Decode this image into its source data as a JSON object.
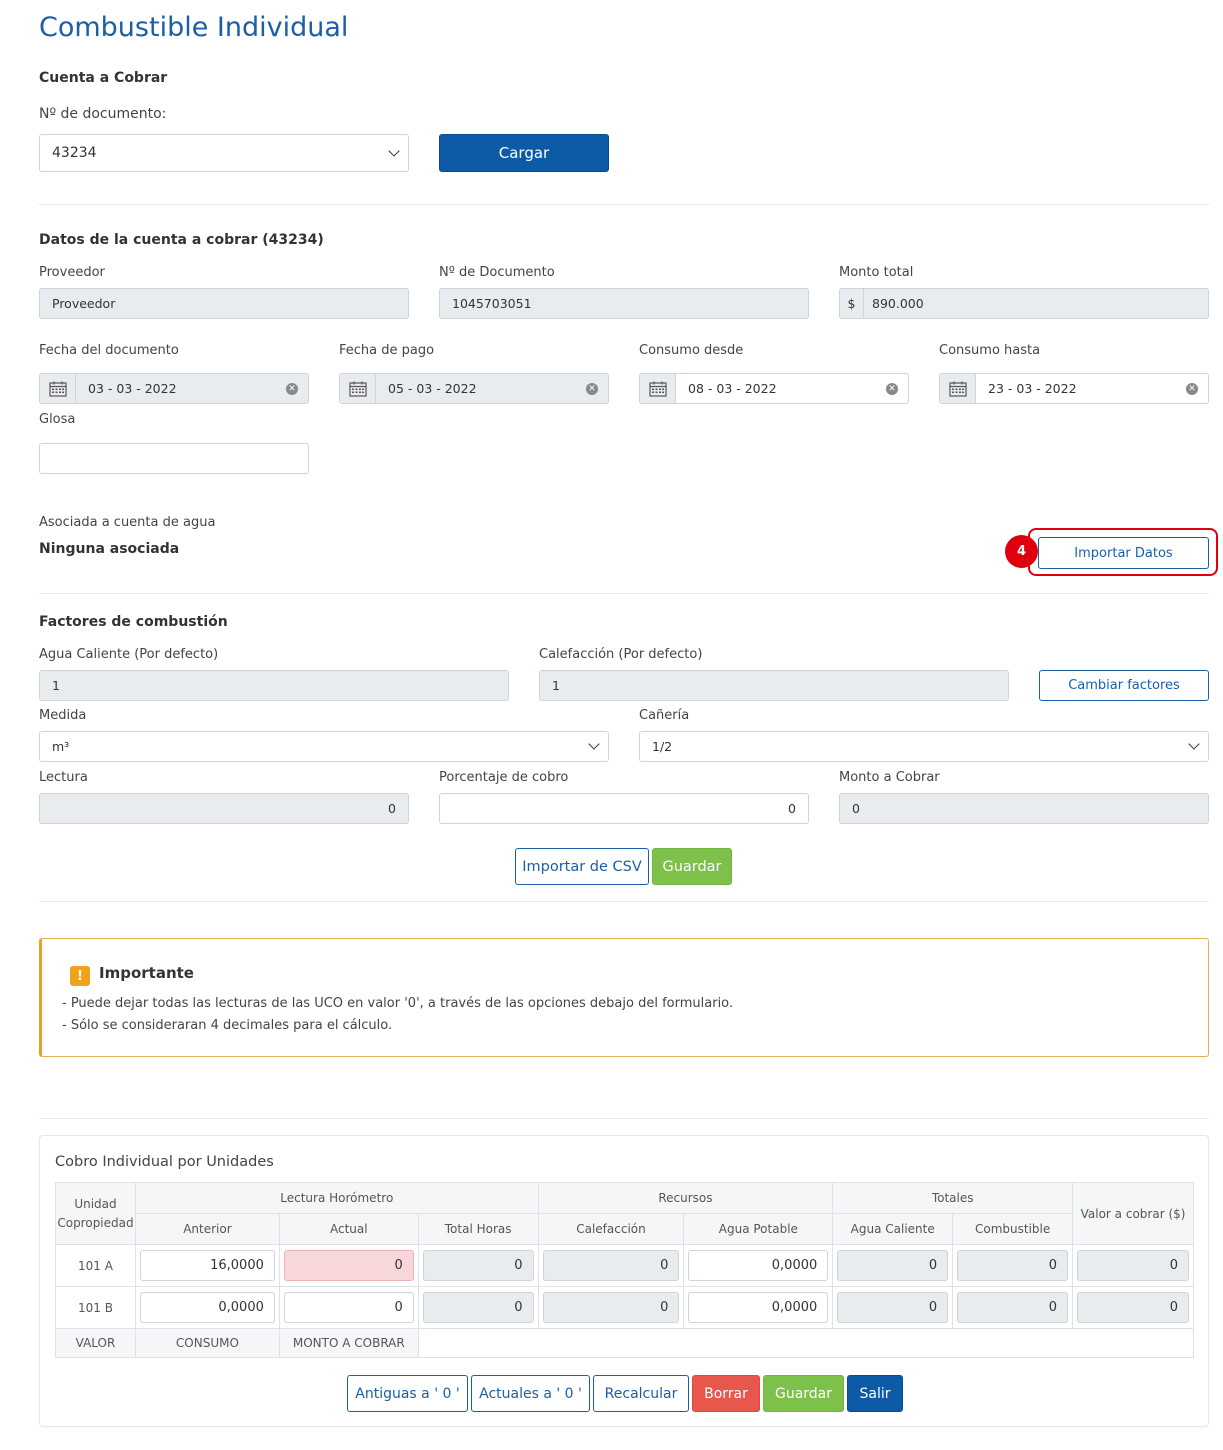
{
  "page_title": "Combustible Individual",
  "cuenta_section": {
    "heading": "Cuenta a Cobrar",
    "doc_label": "Nº de documento:",
    "doc_selected": "43234",
    "load_button": "Cargar"
  },
  "datos": {
    "heading": "Datos de la cuenta a cobrar (43234)",
    "proveedor_label": "Proveedor",
    "proveedor_value": "Proveedor",
    "ndoc_label": "Nº de Documento",
    "ndoc_value": "1045703051",
    "monto_label": "Monto total",
    "monto_prefix": "$",
    "monto_value": "890.000",
    "fecha_doc_label": "Fecha del documento",
    "fecha_doc_value": "03 - 03 - 2022",
    "fecha_pago_label": "Fecha de pago",
    "fecha_pago_value": "05 - 03 - 2022",
    "consumo_desde_label": "Consumo desde",
    "consumo_desde_value": "08 - 03 - 2022",
    "consumo_hasta_label": "Consumo hasta",
    "consumo_hasta_value": "23 - 03 - 2022",
    "glosa_label": "Glosa",
    "glosa_value": "",
    "asociada_label": "Asociada a cuenta de agua",
    "asociada_value": "Ninguna asociada",
    "import_button": "Importar Datos",
    "step_badge": "4"
  },
  "factores": {
    "heading": "Factores de combustión",
    "agua_label": "Agua Caliente (Por defecto)",
    "agua_value": "1",
    "calef_label": "Calefacción (Por defecto)",
    "calef_value": "1",
    "cambiar_button": "Cambiar factores",
    "medida_label": "Medida",
    "medida_value": "m³",
    "caneria_label": "Cañería",
    "caneria_value": "1/2",
    "lectura_label": "Lectura",
    "lectura_value": "0",
    "porcentaje_label": "Porcentaje de cobro",
    "porcentaje_value": "0",
    "monto_cobrar_label": "Monto a Cobrar",
    "monto_cobrar_value": "0",
    "csv_button": "Importar de CSV",
    "save_button": "Guardar"
  },
  "alert": {
    "icon": "exclamation-icon",
    "title": "Importante",
    "line1": "- Puede dejar todas las lecturas de las UCO en valor '0', a través de las opciones debajo del formulario.",
    "line2": "- Sólo se consideraran 4 decimales para el cálculo."
  },
  "table": {
    "title": "Cobro Individual por Unidades",
    "h_unidad": "Unidad Copropiedad",
    "h_lectura": "Lectura Horómetro",
    "h_recursos": "Recursos",
    "h_totales": "Totales",
    "h_valor": "Valor a cobrar ($)",
    "h_anterior": "Anterior",
    "h_actual": "Actual",
    "h_total_horas": "Total Horas",
    "h_calefaccion": "Calefacción",
    "h_agua_potable": "Agua Potable",
    "h_agua_caliente": "Agua Caliente",
    "h_combustible": "Combustible",
    "rows": [
      {
        "unidad": "101 A",
        "anterior": "16,0000",
        "actual": "0",
        "total_horas": "0",
        "calefaccion": "0",
        "agua_potable": "0,0000",
        "agua_caliente": "0",
        "combustible": "0",
        "valor": "0"
      },
      {
        "unidad": "101 B",
        "anterior": "0,0000",
        "actual": "0",
        "total_horas": "0",
        "calefaccion": "0",
        "agua_potable": "0,0000",
        "agua_caliente": "0",
        "combustible": "0",
        "valor": "0"
      }
    ],
    "f_valor": "VALOR",
    "f_consumo": "CONSUMO",
    "f_monto": "MONTO A COBRAR"
  },
  "actions": {
    "antiguas": "Antiguas a ' 0 '",
    "actuales": "Actuales a ' 0 '",
    "recalcular": "Recalcular",
    "borrar": "Borrar",
    "guardar": "Guardar",
    "salir": "Salir"
  },
  "colors": {
    "primary": "#0d5aa7",
    "success": "#7dc14b",
    "danger": "#e8574c",
    "warning": "#f0a21a",
    "highlight": "#e0000d"
  }
}
